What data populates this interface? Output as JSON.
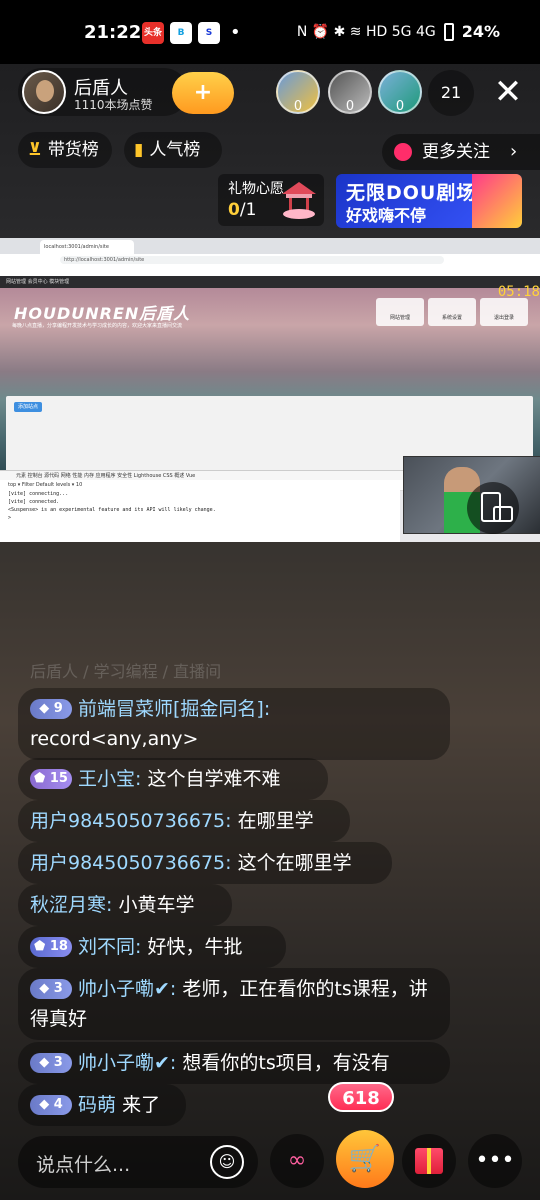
{
  "status_bar": {
    "time": "21:22",
    "apps": [
      "头条",
      "B",
      "S"
    ],
    "indicators": "N ⏰ ✱ ≋ HD 5G 4G",
    "battery": "24%"
  },
  "host": {
    "name": "后盾人",
    "likes": "1110本场点赞",
    "follow_label": "+"
  },
  "viewers": {
    "badges": [
      "0",
      "0",
      "0"
    ],
    "count": "21",
    "close_label": "✕"
  },
  "pills": {
    "goods": "带货榜",
    "popular": "人气榜",
    "more_follow": "更多关注"
  },
  "wish": {
    "title": "礼物心愿",
    "progress": "0",
    "total": "/1"
  },
  "banner": {
    "line1": "无限DOU剧场",
    "line2": "好戏嗨不停"
  },
  "stream": {
    "tab_title": "localhost:3001/admin/site",
    "url": "http://localhost:3001/admin/site",
    "appbar": "网站管理   会员中心   模块管理",
    "logo": "HOUDUNREN后盾人",
    "slogan": "每晚八点直播，分享编程开发技术与学习成长的内容，欢迎大家来直播间交流",
    "buttons": [
      "网站管理",
      "系统设置",
      "退出登录"
    ],
    "card_button": "添加站点",
    "devtools_tabs": "元素   控制台   源代码   网络   性能   内存   应用程序   安全性   Lighthouse   CSS 概述   Vue",
    "devtools_bar": "top  ▾    Filter    Default levels ▾    10",
    "console_lines": [
      "[vite] connecting...",
      "[vite] connected.",
      "<Suspense> is an experimental feature and its API will likely change.",
      ">"
    ],
    "timer": "05:18"
  },
  "faded_line": "后盾人 / 学习编程 / 直播间",
  "chat": [
    {
      "badge": "9",
      "user": "前端冒菜师[掘金同名]:",
      "text": "record<any,any>"
    },
    {
      "badge": "15",
      "user": "王小宝:",
      "text": "这个自学难不难"
    },
    {
      "badge": "",
      "user": "用户9845050736675:",
      "text": "在哪里学"
    },
    {
      "badge": "",
      "user": "用户9845050736675:",
      "text": "这个在哪里学"
    },
    {
      "badge": "",
      "user": "秋涩月寒:",
      "text": "小黄车学"
    },
    {
      "badge": "18",
      "user": "刘不同:",
      "text": "好快，牛批"
    },
    {
      "badge": "3",
      "user": "帅小子嘞✔:",
      "text": "老师，正在看你的ts课程，讲得真好"
    },
    {
      "badge": "3",
      "user": "帅小子嘞✔:",
      "text": "想看你的ts项目，有没有"
    },
    {
      "badge": "4",
      "user": "码萌",
      "text": "来了"
    }
  ],
  "bottom": {
    "input_placeholder": "说点什么...",
    "promo_label": "618",
    "link_icon": "∞",
    "cart_icon": "🛒",
    "more_label": "•••"
  },
  "colors": {
    "accent": "#ffc62a",
    "username": "#9fd9ff",
    "cart": "#ff9a1f"
  }
}
